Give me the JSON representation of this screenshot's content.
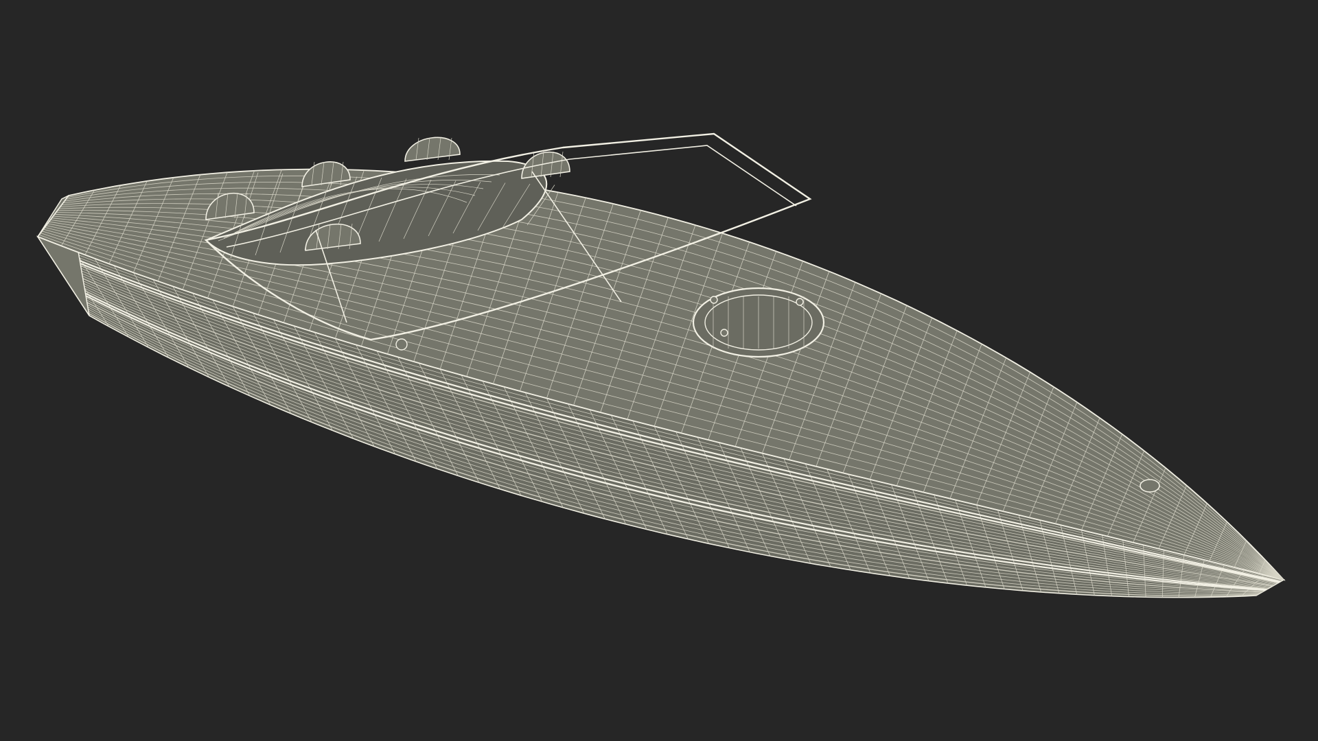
{
  "scene": {
    "subject": "speedboat-wireframe",
    "render_style": "wireframe",
    "colors": {
      "background": "#262626",
      "hull_fill": "#75766b",
      "hull_shade": "#6b6c62",
      "cockpit_fill": "#5f6058",
      "wire": "#f2f0e4",
      "wire_dim": "#d8d6c8"
    },
    "grid": {
      "hull_longitudinal_lines": 26,
      "hull_transverse_lines": 60,
      "deck_longitudinal_lines": 22,
      "deck_transverse_lines": 48
    }
  }
}
